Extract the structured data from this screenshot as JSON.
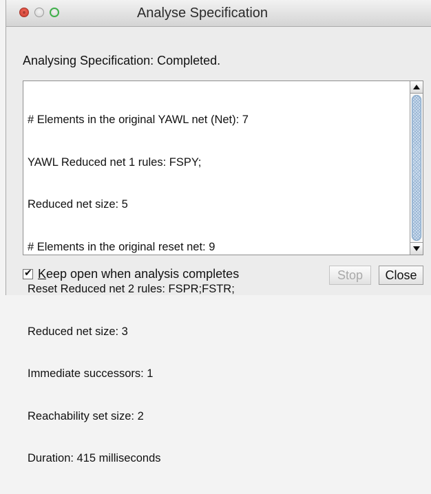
{
  "window": {
    "title": "Analyse Specification"
  },
  "status": {
    "text": "Analysing Specification:  Completed."
  },
  "results": {
    "lines": [
      "# Elements in the original YAWL net (Net): 7",
      "YAWL Reduced net 1 rules: FSPY;",
      "Reduced net size: 5",
      "# Elements in the original reset net: 9",
      "Reset Reduced net 2 rules: FSPR;FSTR;",
      "Reduced net size: 3",
      "Immediate successors: 1",
      "Reachability set size: 2",
      "Duration: 415 milliseconds"
    ]
  },
  "options": {
    "keep_open_mnemonic": "K",
    "keep_open_rest": "eep open when analysis completes",
    "keep_open_checked": true
  },
  "buttons": {
    "stop": "Stop",
    "close": "Close"
  }
}
